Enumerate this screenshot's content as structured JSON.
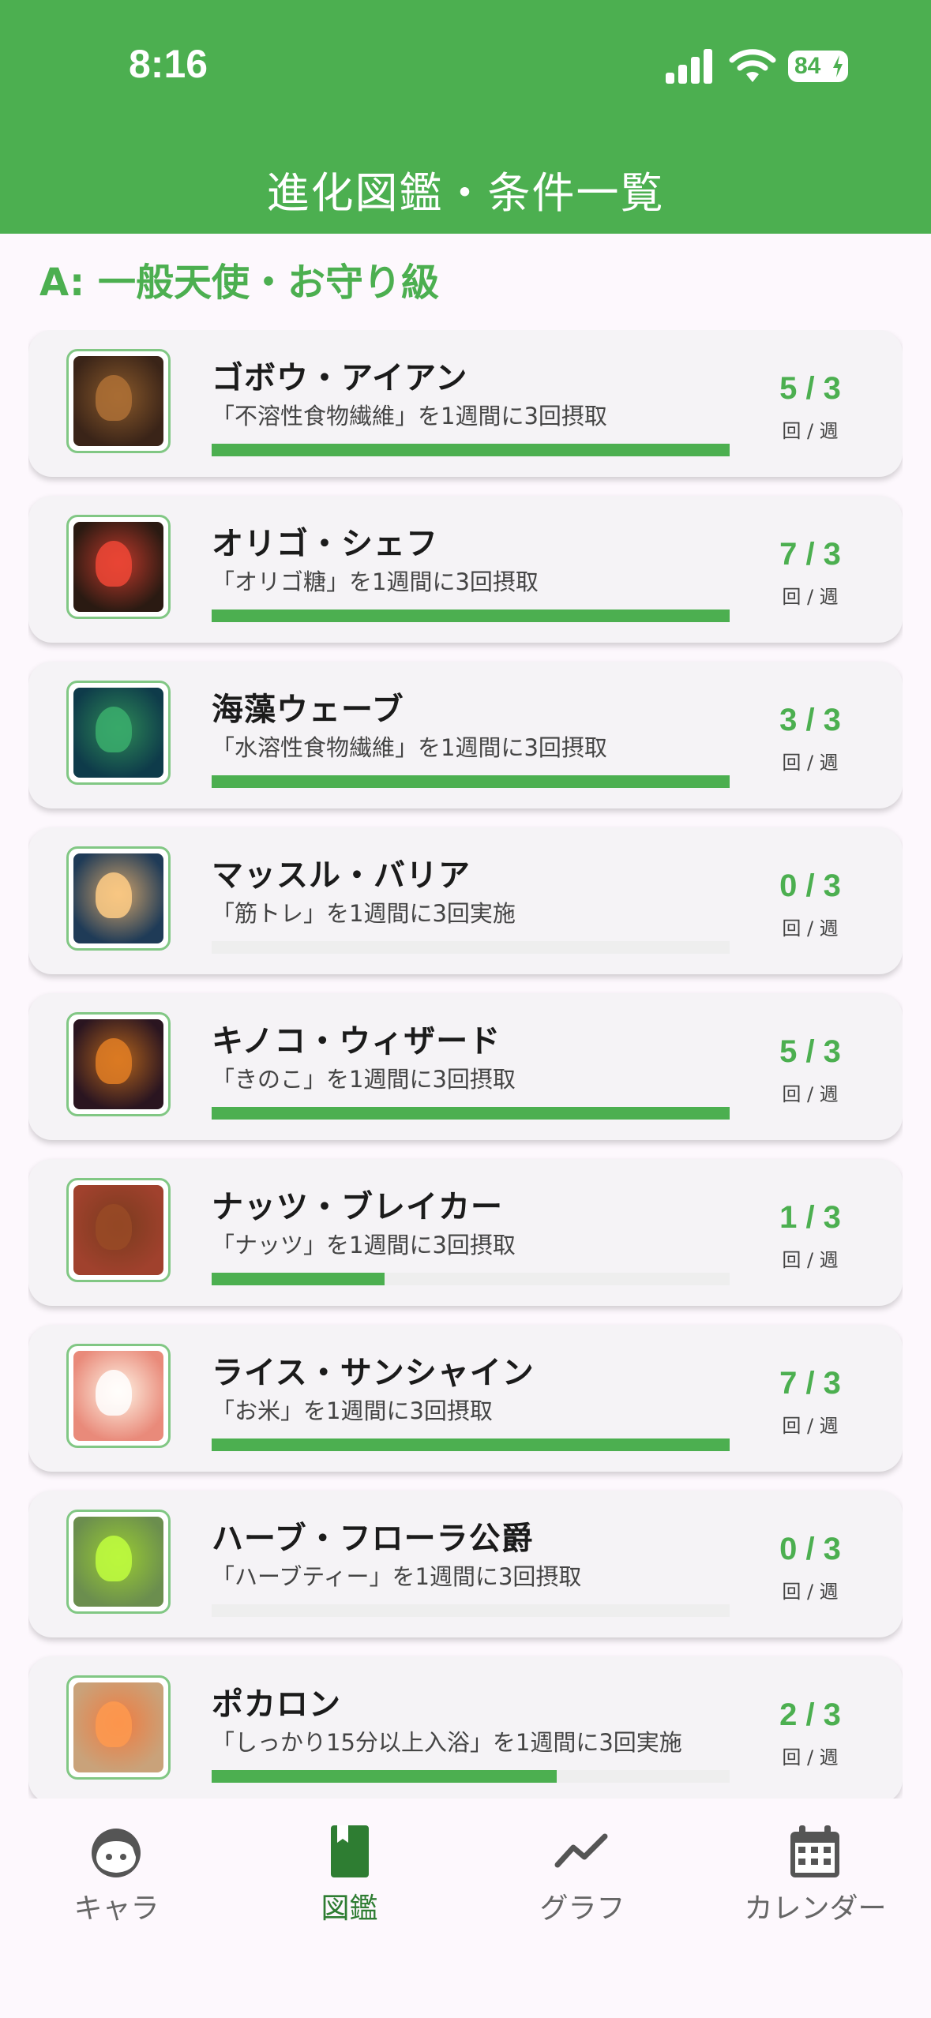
{
  "status_bar": {
    "time": "8:16",
    "battery": "84"
  },
  "header": {
    "title": "進化図鑑・条件一覧"
  },
  "section": {
    "title": "A: 一般天使・お守り級"
  },
  "colors": {
    "accent": "#4caf50",
    "accent_dark": "#2e7d32",
    "track": "#eeeeee"
  },
  "items": [
    {
      "name": "ゴボウ・アイアン",
      "condition": "「不溶性食物繊維」を1週間に3回摂取",
      "count": "5 / 3",
      "unit": "回 / 週",
      "progress": 1.0,
      "icon": "burdock-warrior-image",
      "art": [
        "#3a2418",
        "#8b5a2b"
      ]
    },
    {
      "name": "オリゴ・シェフ",
      "condition": "「オリゴ糖」を1週間に3回摂取",
      "count": "7 / 3",
      "unit": "回 / 週",
      "progress": 1.0,
      "icon": "chef-character-image",
      "art": [
        "#2a1a12",
        "#c0392b"
      ]
    },
    {
      "name": "海藻ウェーブ",
      "condition": "「水溶性食物繊維」を1週間に3回摂取",
      "count": "3 / 3",
      "unit": "回 / 週",
      "progress": 1.0,
      "icon": "seaweed-character-image",
      "art": [
        "#0e3b4a",
        "#2e8b57"
      ]
    },
    {
      "name": "マッスル・バリア",
      "condition": "「筋トレ」を1週間に3回実施",
      "count": "0 / 3",
      "unit": "回 / 週",
      "progress": 0.0,
      "icon": "muscle-character-image",
      "art": [
        "#1f3b57",
        "#d2a46b"
      ]
    },
    {
      "name": "キノコ・ウィザード",
      "condition": "「きのこ」を1週間に3回摂取",
      "count": "5 / 3",
      "unit": "回 / 週",
      "progress": 1.0,
      "icon": "mushroom-wizard-image",
      "art": [
        "#2a1520",
        "#b5651d"
      ]
    },
    {
      "name": "ナッツ・ブレイカー",
      "condition": "「ナッツ」を1週間に3回摂取",
      "count": "1 / 3",
      "unit": "回 / 週",
      "progress": 0.3333,
      "icon": "nut-breaker-image",
      "art": [
        "#a0412d",
        "#7a3b1e"
      ]
    },
    {
      "name": "ライス・サンシャイン",
      "condition": "「お米」を1週間に3回摂取",
      "count": "7 / 3",
      "unit": "回 / 週",
      "progress": 1.0,
      "icon": "rice-character-image",
      "art": [
        "#e98a7a",
        "#fff5e6"
      ]
    },
    {
      "name": "ハーブ・フローラ公爵",
      "condition": "「ハーブティー」を1週間に3回摂取",
      "count": "0 / 3",
      "unit": "回 / 週",
      "progress": 0.0,
      "icon": "herb-character-image",
      "art": [
        "#6b8e4e",
        "#9acd32"
      ]
    },
    {
      "name": "ポカロン",
      "condition": "「しっかり15分以上入浴」を1週間に3回実施",
      "count": "2 / 3",
      "unit": "回 / 週",
      "progress": 0.6667,
      "icon": "bath-character-image",
      "art": [
        "#c9a27a",
        "#f07b3f"
      ]
    }
  ],
  "nav": [
    {
      "label": "キャラ",
      "icon": "character-face-icon",
      "active": false
    },
    {
      "label": "図鑑",
      "icon": "book-icon",
      "active": true
    },
    {
      "label": "グラフ",
      "icon": "chart-line-icon",
      "active": false
    },
    {
      "label": "カレンダー",
      "icon": "calendar-icon",
      "active": false
    }
  ]
}
